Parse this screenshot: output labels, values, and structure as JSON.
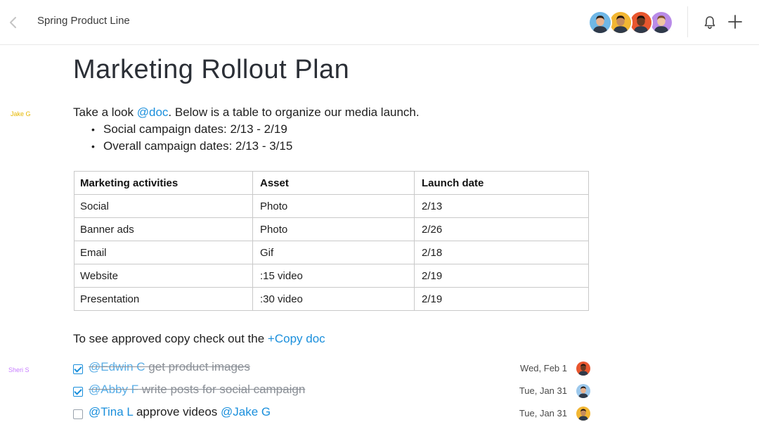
{
  "header": {
    "breadcrumb": "Spring Product Line",
    "avatars": [
      {
        "name": "avatar-1",
        "bg": "#6fb7e6",
        "skin": "#e9b38f",
        "hair": "#2b1d14"
      },
      {
        "name": "avatar-2",
        "bg": "#f2b632",
        "skin": "#c58b5d",
        "hair": "#1f1410"
      },
      {
        "name": "avatar-3",
        "bg": "#e8562e",
        "skin": "#6b3b22",
        "hair": "#150d09"
      },
      {
        "name": "avatar-4",
        "bg": "#b98be8",
        "skin": "#efc5a2",
        "hair": "#7a4b2a"
      }
    ]
  },
  "document": {
    "title": "Marketing Rollout Plan",
    "margin_tags": {
      "jake": "Jake G",
      "sheri": "Sheri S"
    },
    "intro": {
      "before": "Take a look ",
      "mention": "@doc",
      "after": ". Below is a table to organize our media launch."
    },
    "bullets": [
      "Social campaign dates: 2/13 - 2/19",
      "Overall campaign dates: 2/13 - 3/15"
    ],
    "table": {
      "headers": [
        "Marketing activities",
        "Asset",
        "Launch date"
      ],
      "rows": [
        [
          "Social",
          "Photo",
          "2/13"
        ],
        [
          "Banner ads",
          "Photo",
          "2/26"
        ],
        [
          "Email",
          "Gif",
          "2/18"
        ],
        [
          "Website",
          ":15 video",
          "2/19"
        ],
        [
          "Presentation",
          ":30 video",
          "2/19"
        ]
      ]
    },
    "copy_line": {
      "before": "To see approved copy check out the ",
      "link": "+Copy doc"
    },
    "tasks": [
      {
        "checked": true,
        "mention": "@Edwin C",
        "text": " get product images",
        "mention2": "",
        "date": "Wed, Feb 1",
        "avatar_bg": "#e8562e",
        "avatar_skin": "#6b3b22"
      },
      {
        "checked": true,
        "mention": "@Abby F",
        "text": " write posts for social campaign",
        "mention2": "",
        "date": "Tue, Jan 31",
        "avatar_bg": "#9cc8ec",
        "avatar_skin": "#e9b38f"
      },
      {
        "checked": false,
        "mention": "@Tina L",
        "text": " approve videos ",
        "mention2": "@Jake G",
        "date": "Tue, Jan 31",
        "avatar_bg": "#f2b632",
        "avatar_skin": "#c58b5d"
      }
    ]
  }
}
